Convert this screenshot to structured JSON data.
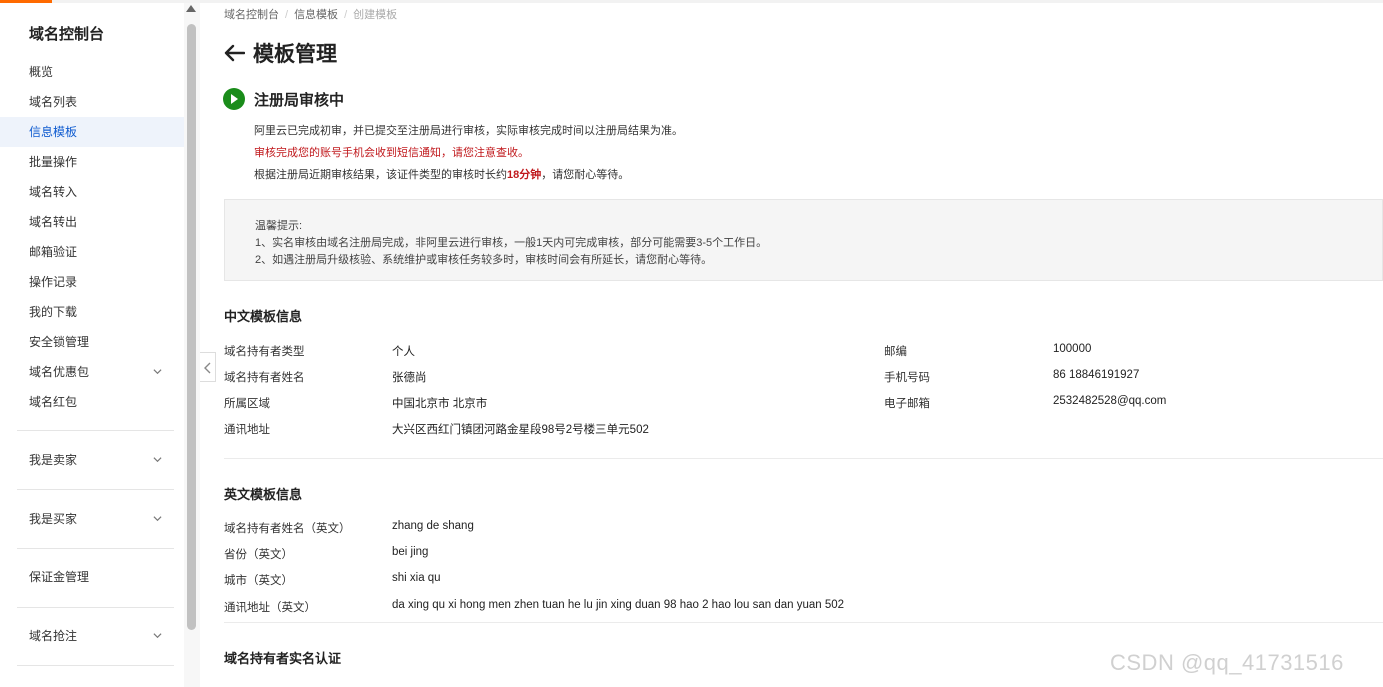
{
  "sidebar": {
    "title": "域名控制台",
    "items": [
      {
        "label": "概览"
      },
      {
        "label": "域名列表"
      },
      {
        "label": "信息模板",
        "active": true
      },
      {
        "label": "批量操作"
      },
      {
        "label": "域名转入"
      },
      {
        "label": "域名转出"
      },
      {
        "label": "邮箱验证"
      },
      {
        "label": "操作记录"
      },
      {
        "label": "我的下载"
      },
      {
        "label": "安全锁管理"
      },
      {
        "label": "域名优惠包",
        "expandable": true
      },
      {
        "label": "域名红包"
      }
    ],
    "groups": [
      {
        "label": "我是卖家",
        "expandable": true
      },
      {
        "label": "我是买家",
        "expandable": true
      },
      {
        "label": "保证金管理"
      },
      {
        "label": "域名抢注",
        "expandable": true
      }
    ]
  },
  "breadcrumb": [
    "域名控制台",
    "信息模板",
    "创建模板"
  ],
  "page_title": "模板管理",
  "status": {
    "title": "注册局审核中",
    "line1": "阿里云已完成初审，并已提交至注册局进行审核，实际审核完成时间以注册局结果为准。",
    "line2": "审核完成您的账号手机会收到短信通知，请您注意查收。",
    "line3_prefix": "根据注册局近期审核结果，该证件类型的审核时长约",
    "line3_highlight": "18分钟",
    "line3_suffix": "，请您耐心等待。"
  },
  "tips": {
    "title": "温馨提示:",
    "items": [
      "1、实名审核由域名注册局完成，非阿里云进行审核，一般1天内可完成审核，部分可能需要3-5个工作日。",
      "2、如遇注册局升级核验、系统维护或审核任务较多时，审核时间会有所延长，请您耐心等待。"
    ]
  },
  "cn_info": {
    "title": "中文模板信息",
    "left": [
      {
        "label": "域名持有者类型",
        "value": "个人"
      },
      {
        "label": "域名持有者姓名",
        "value": "张德尚"
      },
      {
        "label": "所属区域",
        "value": "中国北京市 北京市"
      },
      {
        "label": "通讯地址",
        "value": "大兴区西红门镇团河路金星段98号2号楼三单元502"
      }
    ],
    "right": [
      {
        "label": "邮编",
        "value": "100000"
      },
      {
        "label": "手机号码",
        "value": "86 18846191927"
      },
      {
        "label": "电子邮箱",
        "value": "2532482528@qq.com"
      }
    ]
  },
  "en_info": {
    "title": "英文模板信息",
    "rows": [
      {
        "label": "域名持有者姓名（英文）",
        "value": "zhang de shang"
      },
      {
        "label": "省份（英文）",
        "value": "bei jing"
      },
      {
        "label": "城市（英文）",
        "value": "shi xia qu"
      },
      {
        "label": "通讯地址（英文）",
        "value": "da xing qu xi hong men zhen tuan he lu jin xing duan 98 hao 2 hao lou san dan yuan 502"
      }
    ]
  },
  "realname": {
    "title": "域名持有者实名认证"
  },
  "watermark": "CSDN @qq_41731516",
  "colors": {
    "accent": "#0f5bd0",
    "brand": "#ff6a00",
    "status_green": "#1a8c1a",
    "warning_red": "#c0181c"
  }
}
